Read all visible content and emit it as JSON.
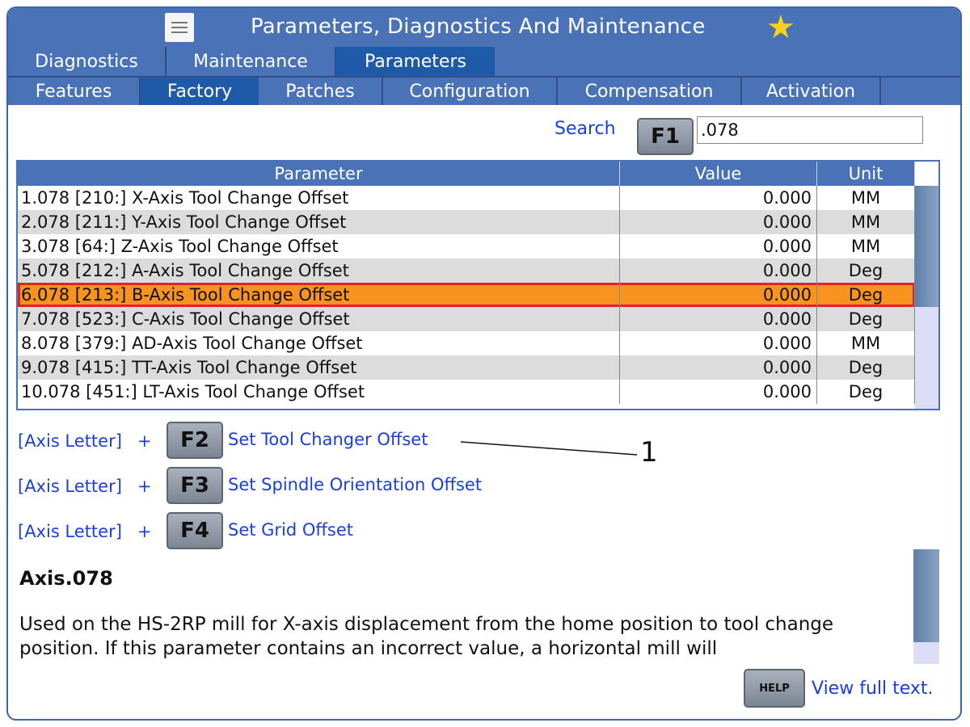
{
  "title": "Parameters, Diagnostics And Maintenance",
  "top_tabs": [
    {
      "label": "Diagnostics",
      "active": false
    },
    {
      "label": "Maintenance",
      "active": false
    },
    {
      "label": "Parameters",
      "active": true
    }
  ],
  "sub_tabs": [
    {
      "label": "Features",
      "active": false
    },
    {
      "label": "Factory",
      "active": true
    },
    {
      "label": "Patches",
      "active": false
    },
    {
      "label": "Configuration",
      "active": false
    },
    {
      "label": "Compensation",
      "active": false
    },
    {
      "label": "Activation",
      "active": false
    }
  ],
  "search": {
    "label": "Search",
    "key": "F1",
    "value": ".078"
  },
  "table": {
    "headers": {
      "parameter": "Parameter",
      "value": "Value",
      "unit": "Unit"
    },
    "rows": [
      {
        "parameter": "1.078 [210:] X-Axis Tool Change Offset",
        "value": "0.000",
        "unit": "MM",
        "selected": false
      },
      {
        "parameter": "2.078 [211:] Y-Axis Tool Change Offset",
        "value": "0.000",
        "unit": "MM",
        "selected": false
      },
      {
        "parameter": "3.078 [64:] Z-Axis Tool Change Offset",
        "value": "0.000",
        "unit": "MM",
        "selected": false
      },
      {
        "parameter": "5.078 [212:] A-Axis Tool Change Offset",
        "value": "0.000",
        "unit": "Deg",
        "selected": false
      },
      {
        "parameter": "6.078 [213:] B-Axis Tool Change Offset",
        "value": "0.000",
        "unit": "Deg",
        "selected": true
      },
      {
        "parameter": "7.078 [523:] C-Axis Tool Change Offset",
        "value": "0.000",
        "unit": "Deg",
        "selected": false
      },
      {
        "parameter": "8.078 [379:] AD-Axis Tool Change Offset",
        "value": "0.000",
        "unit": "MM",
        "selected": false
      },
      {
        "parameter": "9.078 [415:] TT-Axis Tool Change Offset",
        "value": "0.000",
        "unit": "Deg",
        "selected": false
      },
      {
        "parameter": "10.078 [451:] LT-Axis Tool Change Offset",
        "value": "0.000",
        "unit": "Deg",
        "selected": false
      }
    ]
  },
  "shortcuts": [
    {
      "label": "[Axis Letter]",
      "plus": "+",
      "key": "F2",
      "desc": "Set Tool Changer Offset"
    },
    {
      "label": "[Axis Letter]",
      "plus": "+",
      "key": "F3",
      "desc": "Set Spindle Orientation Offset"
    },
    {
      "label": "[Axis Letter]",
      "plus": "+",
      "key": "F4",
      "desc": "Set Grid Offset"
    }
  ],
  "callout": "1",
  "description": {
    "title": "Axis.078",
    "text": "Used on the HS-2RP mill for X-axis displacement from the home position to tool change position. If this parameter contains an incorrect value, a horizontal mill will"
  },
  "help": {
    "key": "HELP",
    "link": "View full text."
  },
  "colors": {
    "title_bar": "#4a72b6",
    "active_tab": "#1f5aa8",
    "selected_row": "#f7931e",
    "selected_outline": "#e0232b",
    "link": "#1a3ee0"
  }
}
